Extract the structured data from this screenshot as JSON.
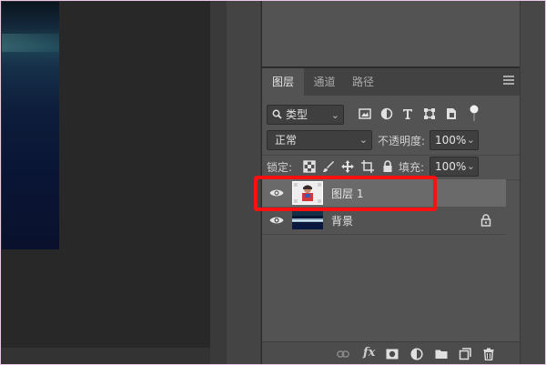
{
  "layers_panel": {
    "tabs": [
      {
        "label": "图层",
        "active": true
      },
      {
        "label": "通道",
        "active": false
      },
      {
        "label": "路径",
        "active": false
      }
    ],
    "filter": {
      "kind_label": "类型",
      "icons": [
        "image-filter-icon",
        "adjustment-filter-icon",
        "type-filter-icon",
        "shape-filter-icon",
        "smart-object-filter-icon",
        "filter-toggle-icon"
      ]
    },
    "blend_mode": "正常",
    "opacity_label": "不透明度:",
    "opacity_value": "100%",
    "lock_label": "锁定:",
    "lock_icons": [
      "lock-transparent-icon",
      "lock-image-icon",
      "lock-position-icon",
      "lock-artboard-icon",
      "lock-all-icon"
    ],
    "fill_label": "填充:",
    "fill_value": "100%",
    "layers": [
      {
        "name": "图层 1",
        "visible": true,
        "selected": true,
        "locked": false
      },
      {
        "name": "背景",
        "visible": true,
        "selected": false,
        "locked": true
      }
    ],
    "bottom_icons": [
      "link-layers-icon",
      "fx-icon",
      "layer-mask-icon",
      "adjustment-layer-icon",
      "group-folder-icon",
      "new-layer-icon",
      "delete-layer-icon"
    ],
    "fx_label": "fx"
  },
  "colors": {
    "panel_bg": "#535353",
    "tabbar_bg": "#424242",
    "selected_layer_bg": "#6a6a6a",
    "highlight_red": "#ff1010"
  }
}
